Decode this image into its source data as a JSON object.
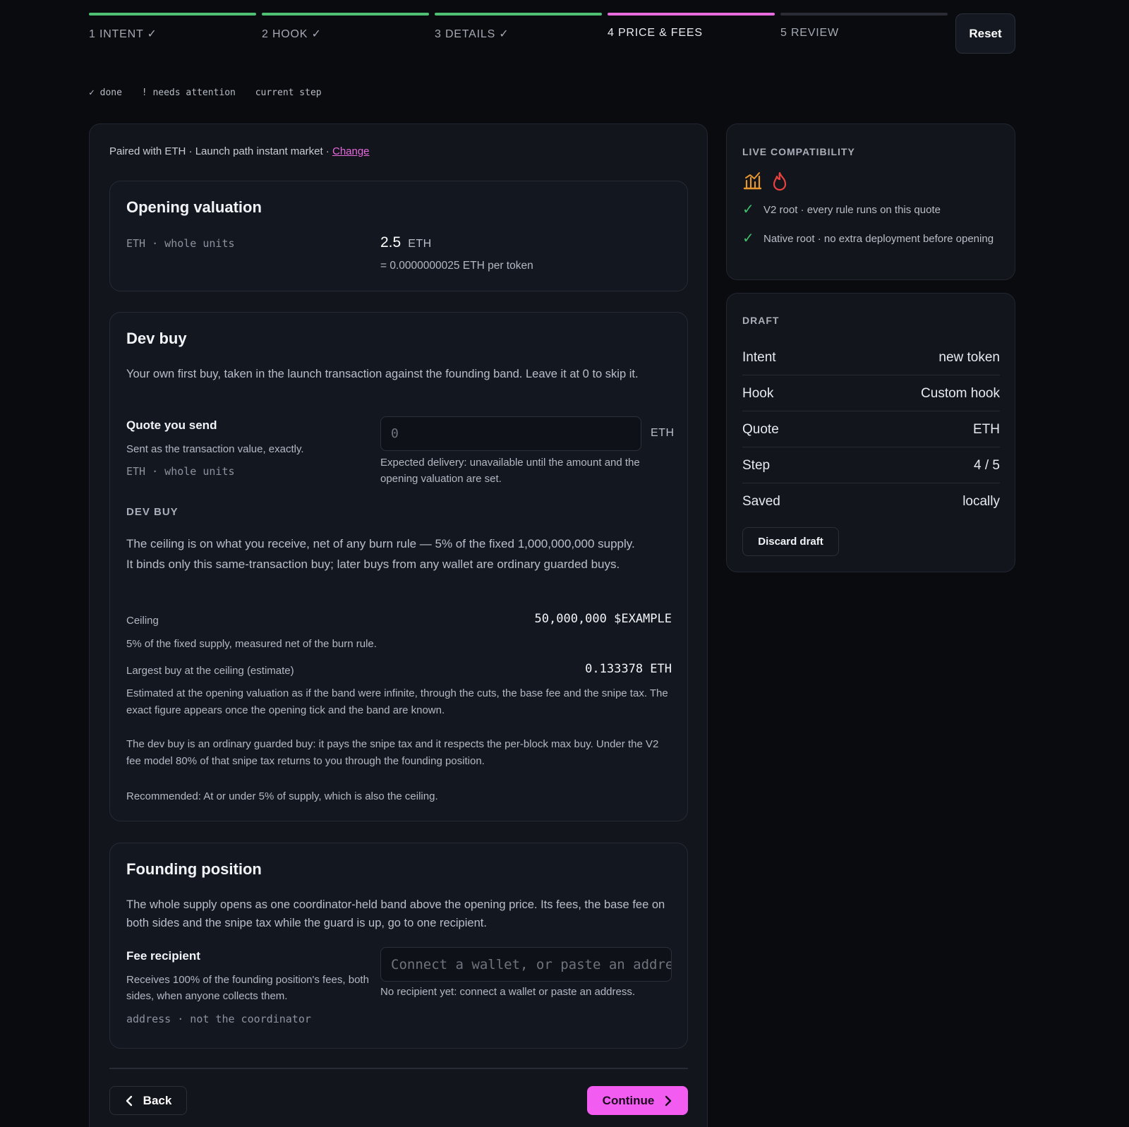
{
  "stepper": {
    "steps": [
      {
        "label": "1 INTENT ✓",
        "state": "done"
      },
      {
        "label": "2 HOOK ✓",
        "state": "done"
      },
      {
        "label": "3 DETAILS ✓",
        "state": "done"
      },
      {
        "label": "4 PRICE & FEES",
        "state": "current"
      },
      {
        "label": "5 REVIEW",
        "state": "pending"
      }
    ],
    "reset_label": "Reset"
  },
  "legend": {
    "done": "✓ done",
    "attention": "! needs attention",
    "current": "current step"
  },
  "main": {
    "paired_text": "Paired with ETH · Launch path instant market · ",
    "change_link": "Change",
    "opening": {
      "title": "Opening valuation",
      "unit_hint": "ETH · whole units",
      "value": "2.5",
      "currency": "ETH",
      "per_token": "= 0.0000000025 ETH per token"
    },
    "devbuy": {
      "title": "Dev buy",
      "description": "Your own first buy, taken in the launch transaction against the founding band. Leave it at 0 to skip it.",
      "quote_label": "Quote you send",
      "quote_sub": "Sent as the transaction value, exactly.",
      "quote_units": "ETH · whole units",
      "input_placeholder": "0",
      "input_currency": "ETH",
      "expected": "Expected delivery: unavailable until the amount and the opening valuation are set.",
      "section_label": "DEV BUY",
      "ceiling_desc": "The ceiling is on what you receive, net of any burn rule — 5% of the fixed 1,000,000,000 supply. It binds only this same-transaction buy; later buys from any wallet are ordinary guarded buys.",
      "ceiling_label": "Ceiling",
      "ceiling_value": "50,000,000 $EXAMPLE",
      "ceiling_note": "5% of the fixed supply, measured net of the burn rule.",
      "largest_label": "Largest buy at the ceiling (estimate)",
      "largest_value": "0.133378 ETH",
      "largest_note": "Estimated at the opening valuation as if the band were infinite, through the cuts, the base fee and the snipe tax. The exact figure appears once the opening tick and the band are known.",
      "guarded_note": "The dev buy is an ordinary guarded buy: it pays the snipe tax and it respects the per-block max buy. Under the V2 fee model 80% of that snipe tax returns to you through the founding position.",
      "recommended": "Recommended: At or under 5% of supply, which is also the ceiling."
    },
    "founding": {
      "title": "Founding position",
      "description": "The whole supply opens as one coordinator-held band above the opening price. Its fees, the base fee on both sides and the snipe tax while the guard is up, go to one recipient.",
      "fee_label": "Fee recipient",
      "fee_sub": "Receives 100% of the founding position's fees, both sides, when anyone collects them.",
      "fee_units": "address · not the coordinator",
      "input_placeholder": "Connect a wallet, or paste an address",
      "no_recipient": "No recipient yet: connect a wallet or paste an address."
    },
    "back_label": "Back",
    "continue_label": "Continue"
  },
  "compat": {
    "title": "LIVE COMPATIBILITY",
    "items": [
      "V2 root · every rule runs on this quote",
      "Native root · no extra deployment before opening"
    ]
  },
  "draft": {
    "title": "DRAFT",
    "rows": [
      {
        "label": "Intent",
        "value": "new token"
      },
      {
        "label": "Hook",
        "value": "Custom hook"
      },
      {
        "label": "Quote",
        "value": "ETH"
      },
      {
        "label": "Step",
        "value": "4 / 5"
      },
      {
        "label": "Saved",
        "value": "locally"
      }
    ],
    "discard_label": "Discard draft"
  },
  "colors": {
    "done": "#4fbf73",
    "current": "#e86bdd",
    "accent": "#f25cf0",
    "check": "#3fbf6a",
    "chart_icon": "#e8962e",
    "flame_icon": "#e8423f"
  }
}
